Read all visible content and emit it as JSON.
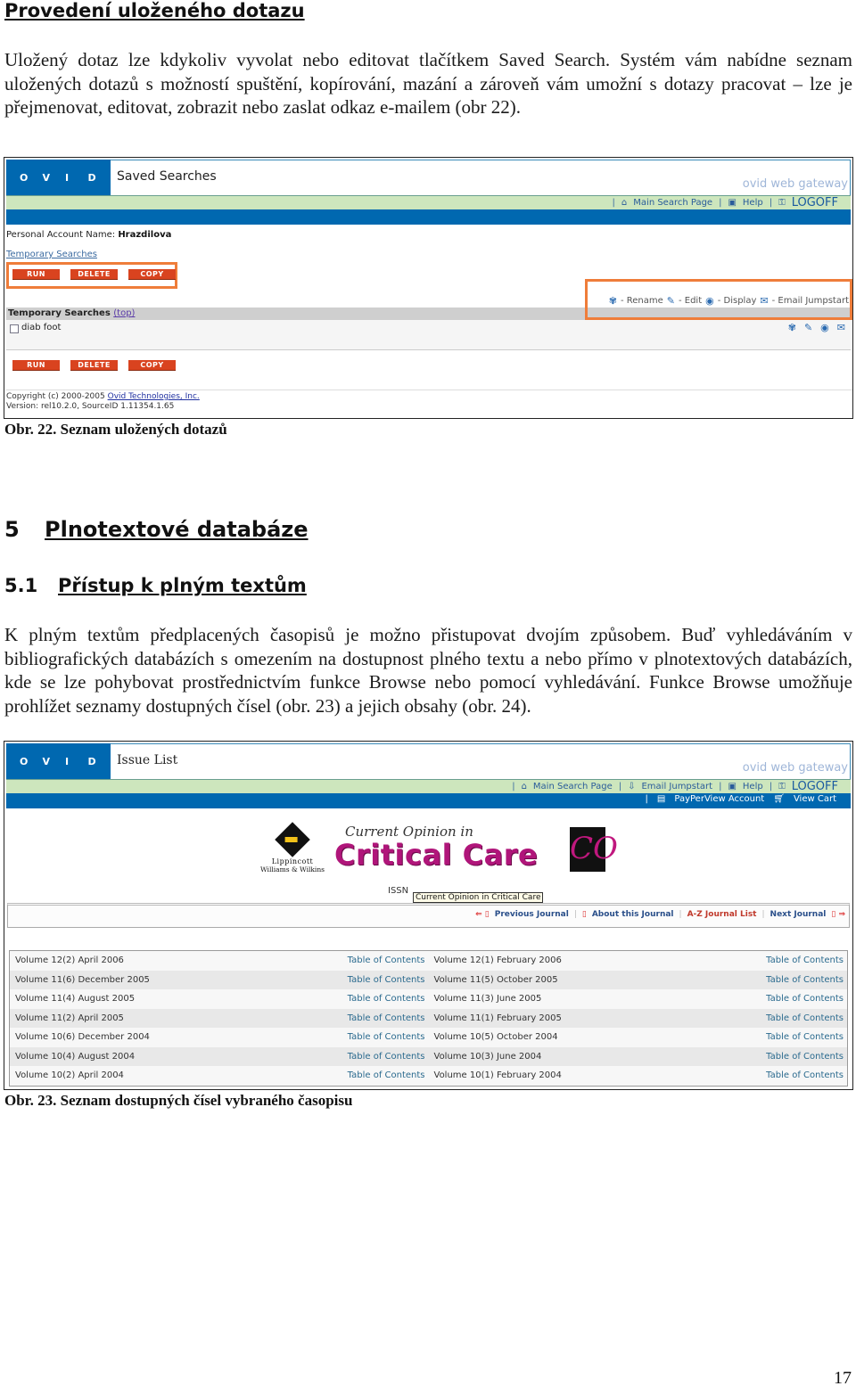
{
  "section_heading": "Provedení uloženého dotazu",
  "paragraph1": "Uložený dotaz lze kdykoliv vyvolat nebo editovat tlačítkem Saved Search. Systém vám nabídne seznam uložených dotazů s možností spuštění, kopírování, mazání a zároveň vám umožní s dotazy pracovat – lze je přejmenovat, editovat, zobrazit nebo zaslat odkaz e-mailem (obr 22).",
  "figure22": {
    "logo_letters": [
      "O",
      "V",
      "I",
      "D"
    ],
    "page_title": "Saved Searches",
    "gateway_label": "ovid web gateway",
    "top_links": [
      "Main Search Page",
      "Help",
      "LOGOFF"
    ],
    "account_label": "Personal Account Name:",
    "account_name": "Hrazdilova",
    "temporary_link": "Temporary Searches",
    "buttons": [
      "RUN",
      "DELETE",
      "COPY"
    ],
    "legend": [
      {
        "icon": "rename-icon",
        "label": "- Rename"
      },
      {
        "icon": "edit-pencil-icon",
        "label": "- Edit"
      },
      {
        "icon": "display-eye-icon",
        "label": "- Display"
      },
      {
        "icon": "email-jumpstart-icon",
        "label": "- Email Jumpstart"
      }
    ],
    "section_bar_label": "Temporary Searches",
    "section_bar_link": "(top)",
    "saved_items": [
      {
        "label": "diab foot",
        "checked": false
      }
    ],
    "copyright_text": "Copyright (c) 2000-2005",
    "copyright_link": "Ovid Technologies, Inc.",
    "version_text": "Version: rel10.2.0, SourceID 1.11354.1.65",
    "caption": "Obr. 22. Seznam uložených dotazů"
  },
  "chapter": {
    "number": "5",
    "title": "Plnotextové databáze"
  },
  "subchapter": {
    "number": "5.1",
    "title": "Přístup k plným textům"
  },
  "paragraph2": "K plným textům předplacených časopisů je možno přistupovat dvojím způsobem. Buď vyhledáváním v bibliografických databázích s omezením na dostupnost plného textu a nebo přímo v plnotextových databázích, kde se lze pohybovat prostřednictvím funkce Browse nebo pomocí vyhledávání. Funkce Browse umožňuje prohlížet seznamy dostupných čísel (obr. 23) a jejich obsahy (obr. 24).",
  "figure23": {
    "page_title": "Issue List",
    "gateway_label": "ovid web gateway",
    "top_links": [
      "Main Search Page",
      "Email Jumpstart",
      "Help",
      "LOGOFF"
    ],
    "blue_links": [
      "PayPerView Account",
      "View Cart"
    ],
    "publisher_line1": "Lippincott",
    "publisher_line2": "Williams & Wilkins",
    "journal_title_line1": "Current Opinion in",
    "journal_title_line2": "Critical Care",
    "journal_logo": "CO",
    "issn_label": "ISSN",
    "tooltip": "Current Opinion in Critical Care",
    "nav_links": [
      "Previous Journal",
      "About this Journal",
      "A-Z Journal List",
      "Next Journal"
    ],
    "toc_label": "Table of Contents",
    "issues": [
      [
        "Volume 12(2) April 2006",
        "Volume 12(1) February 2006"
      ],
      [
        "Volume 11(6) December 2005",
        "Volume 11(5) October 2005"
      ],
      [
        "Volume 11(4) August 2005",
        "Volume 11(3) June 2005"
      ],
      [
        "Volume 11(2) April 2005",
        "Volume 11(1) February 2005"
      ],
      [
        "Volume 10(6) December 2004",
        "Volume 10(5) October 2004"
      ],
      [
        "Volume 10(4) August 2004",
        "Volume 10(3) June 2004"
      ],
      [
        "Volume 10(2) April 2004",
        "Volume 10(1) February 2004"
      ]
    ],
    "caption": "Obr. 23. Seznam dostupných čísel vybraného časopisu"
  },
  "page_number": "17",
  "colors": {
    "ovid_blue": "#0068b0",
    "green_band": "#cde6bd",
    "button_red": "#d9431f",
    "highlight_orange": "#ef7d3a",
    "journal_magenta": "#b0157a"
  }
}
